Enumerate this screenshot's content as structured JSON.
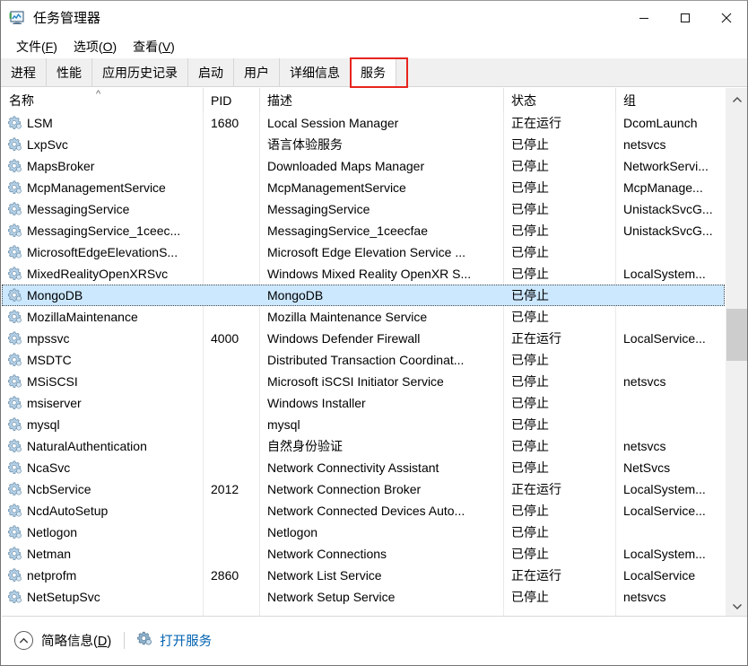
{
  "window": {
    "title": "任务管理器",
    "icon": "task-manager-icon",
    "minimize_label": "最小化",
    "maximize_label": "最大化",
    "close_label": "关闭"
  },
  "menubar": {
    "items": [
      {
        "label": "文件(F)",
        "text": "文件",
        "accel": "F"
      },
      {
        "label": "选项(O)",
        "text": "选项",
        "accel": "O"
      },
      {
        "label": "查看(V)",
        "text": "查看",
        "accel": "V"
      }
    ]
  },
  "tabs": {
    "items": [
      {
        "label": "进程",
        "selected": false
      },
      {
        "label": "性能",
        "selected": false
      },
      {
        "label": "应用历史记录",
        "selected": false
      },
      {
        "label": "启动",
        "selected": false
      },
      {
        "label": "用户",
        "selected": false
      },
      {
        "label": "详细信息",
        "selected": false
      },
      {
        "label": "服务",
        "selected": true
      }
    ],
    "highlight_color": "#e8241e",
    "highlighted_tab": "服务"
  },
  "table": {
    "columns": [
      {
        "key": "name",
        "label": "名称",
        "sorted": "asc",
        "sort_glyph": "^"
      },
      {
        "key": "pid",
        "label": "PID"
      },
      {
        "key": "description",
        "label": "描述"
      },
      {
        "key": "status",
        "label": "状态"
      },
      {
        "key": "group",
        "label": "组"
      }
    ],
    "selected_row_index": 8,
    "selection_color": "#cce8ff",
    "rows": [
      {
        "name": "LSM",
        "pid": "1680",
        "description": "Local Session Manager",
        "status": "正在运行",
        "group": "DcomLaunch"
      },
      {
        "name": "LxpSvc",
        "pid": "",
        "description": "语言体验服务",
        "status": "已停止",
        "group": "netsvcs"
      },
      {
        "name": "MapsBroker",
        "pid": "",
        "description": "Downloaded Maps Manager",
        "status": "已停止",
        "group": "NetworkServi..."
      },
      {
        "name": "McpManagementService",
        "pid": "",
        "description": "McpManagementService",
        "status": "已停止",
        "group": "McpManage..."
      },
      {
        "name": "MessagingService",
        "pid": "",
        "description": "MessagingService",
        "status": "已停止",
        "group": "UnistackSvcG..."
      },
      {
        "name": "MessagingService_1ceec...",
        "pid": "",
        "description": "MessagingService_1ceecfae",
        "status": "已停止",
        "group": "UnistackSvcG..."
      },
      {
        "name": "MicrosoftEdgeElevationS...",
        "pid": "",
        "description": "Microsoft Edge Elevation Service ...",
        "status": "已停止",
        "group": ""
      },
      {
        "name": "MixedRealityOpenXRSvc",
        "pid": "",
        "description": "Windows Mixed Reality OpenXR S...",
        "status": "已停止",
        "group": "LocalSystem..."
      },
      {
        "name": "MongoDB",
        "pid": "",
        "description": "MongoDB",
        "status": "已停止",
        "group": ""
      },
      {
        "name": "MozillaMaintenance",
        "pid": "",
        "description": "Mozilla Maintenance Service",
        "status": "已停止",
        "group": ""
      },
      {
        "name": "mpssvc",
        "pid": "4000",
        "description": "Windows Defender Firewall",
        "status": "正在运行",
        "group": "LocalService..."
      },
      {
        "name": "MSDTC",
        "pid": "",
        "description": "Distributed Transaction Coordinat...",
        "status": "已停止",
        "group": ""
      },
      {
        "name": "MSiSCSI",
        "pid": "",
        "description": "Microsoft iSCSI Initiator Service",
        "status": "已停止",
        "group": "netsvcs"
      },
      {
        "name": "msiserver",
        "pid": "",
        "description": "Windows Installer",
        "status": "已停止",
        "group": ""
      },
      {
        "name": "mysql",
        "pid": "",
        "description": "mysql",
        "status": "已停止",
        "group": ""
      },
      {
        "name": "NaturalAuthentication",
        "pid": "",
        "description": "自然身份验证",
        "status": "已停止",
        "group": "netsvcs"
      },
      {
        "name": "NcaSvc",
        "pid": "",
        "description": "Network Connectivity Assistant",
        "status": "已停止",
        "group": "NetSvcs"
      },
      {
        "name": "NcbService",
        "pid": "2012",
        "description": "Network Connection Broker",
        "status": "正在运行",
        "group": "LocalSystem..."
      },
      {
        "name": "NcdAutoSetup",
        "pid": "",
        "description": "Network Connected Devices Auto...",
        "status": "已停止",
        "group": "LocalService..."
      },
      {
        "name": "Netlogon",
        "pid": "",
        "description": "Netlogon",
        "status": "已停止",
        "group": ""
      },
      {
        "name": "Netman",
        "pid": "",
        "description": "Network Connections",
        "status": "已停止",
        "group": "LocalSystem..."
      },
      {
        "name": "netprofm",
        "pid": "2860",
        "description": "Network List Service",
        "status": "正在运行",
        "group": "LocalService"
      },
      {
        "name": "NetSetupSvc",
        "pid": "",
        "description": "Network Setup Service",
        "status": "已停止",
        "group": "netsvcs"
      }
    ]
  },
  "scrollbar": {
    "up_glyph": "^",
    "down_glyph": "v"
  },
  "statusbar": {
    "fewer_details_label": "简略信息(D)",
    "fewer_details_text": "简略信息",
    "fewer_details_accel": "D",
    "open_services_label": "打开服务",
    "open_services_color": "#0062b1"
  }
}
